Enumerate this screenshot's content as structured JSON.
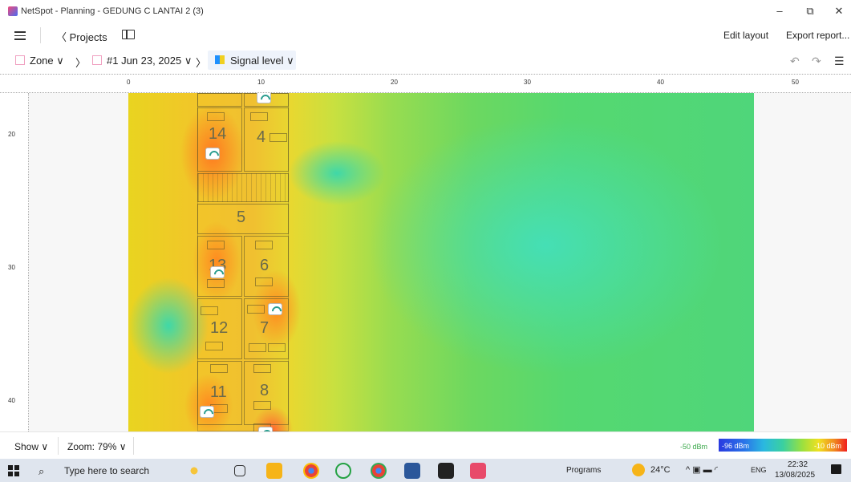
{
  "window": {
    "title": "NetSpot - Planning - GEDUNG C LANTAI 2 (3)",
    "minimize": "–",
    "maximize": "⧉",
    "close": "✕"
  },
  "toolbar": {
    "projects_label": "〈 Projects",
    "edit_layout_label": "Edit layout",
    "export_report_label": "Export report..."
  },
  "breadcrumbs": {
    "zone_label": "Zone ∨",
    "separator": "〉",
    "snapshot_label": "#1 Jun 23, 2025 ∨",
    "visualization_label": "Signal level ∨"
  },
  "ruler": {
    "x_ticks": [
      "0",
      "10",
      "20",
      "30",
      "40",
      "50"
    ],
    "y_ticks": [
      "20",
      "30",
      "40"
    ]
  },
  "rooms": [
    {
      "label": "14"
    },
    {
      "label": "4"
    },
    {
      "label": "5"
    },
    {
      "label": "13"
    },
    {
      "label": "6"
    },
    {
      "label": "12"
    },
    {
      "label": "7"
    },
    {
      "label": "11"
    },
    {
      "label": "8"
    }
  ],
  "statusbar": {
    "show_label": "Show ∨",
    "zoom_label": "Zoom: 79% ∨"
  },
  "legend": {
    "min_label": "-50 dBm",
    "low_label": "-96 dBm",
    "high_label": "-10 dBm"
  },
  "taskbar": {
    "search_placeholder": "Type here to search",
    "programs_label": "Programs",
    "weather_text": "24°C",
    "lang_label": "ENG",
    "time": "22:32",
    "date": "13/08/2025"
  }
}
